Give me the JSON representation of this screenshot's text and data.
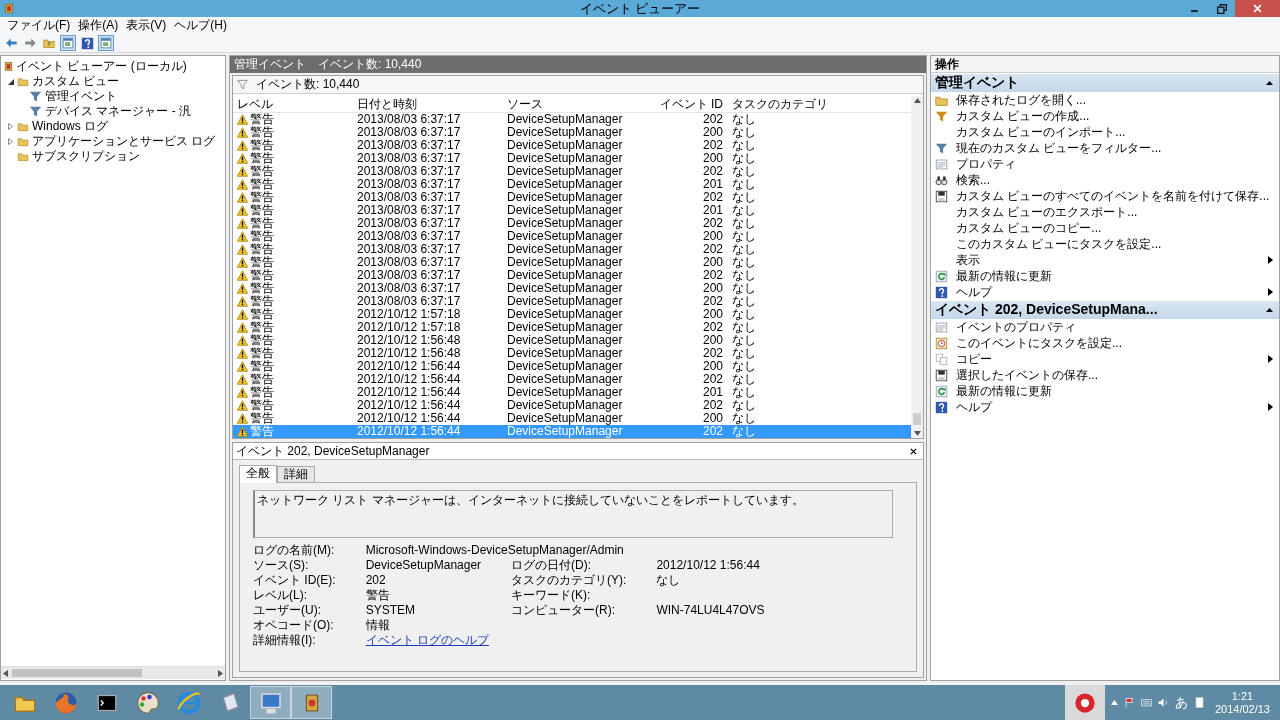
{
  "window": {
    "title": "イベント ビューアー"
  },
  "menu": [
    "ファイル(F)",
    "操作(A)",
    "表示(V)",
    "ヘルプ(H)"
  ],
  "toolbar": [
    {
      "kind": "back",
      "pressed": false
    },
    {
      "kind": "forward",
      "pressed": false
    },
    {
      "kind": "up",
      "pressed": false
    },
    {
      "kind": "pane",
      "pressed": true
    },
    {
      "kind": "help",
      "pressed": false
    },
    {
      "kind": "pane",
      "pressed": true
    }
  ],
  "tree": {
    "root": "イベント ビューアー (ローカル)",
    "items": [
      {
        "label": "カスタム ビュー",
        "expanded": true,
        "children": [
          {
            "label": "管理イベント",
            "kind": "view"
          },
          {
            "label": "デバイス マネージャー - 汎",
            "kind": "view"
          }
        ]
      },
      {
        "label": "Windows ログ",
        "expanded": false
      },
      {
        "label": "アプリケーションとサービス ログ",
        "expanded": false
      },
      {
        "label": "サブスクリプション"
      }
    ]
  },
  "list_panel": {
    "title": "管理イベント",
    "count": "イベント数: 10,440",
    "filter_text": "イベント数: 10,440",
    "columns": [
      "レベル",
      "日付と時刻",
      "ソース",
      "イベント ID",
      "タスクのカテゴリ"
    ],
    "rows": [
      {
        "level": "警告",
        "datetime": "2013/08/03 6:37:17",
        "source": "DeviceSetupManager",
        "event_id": "202",
        "category": "なし",
        "selected": false
      },
      {
        "level": "警告",
        "datetime": "2013/08/03 6:37:17",
        "source": "DeviceSetupManager",
        "event_id": "200",
        "category": "なし",
        "selected": false
      },
      {
        "level": "警告",
        "datetime": "2013/08/03 6:37:17",
        "source": "DeviceSetupManager",
        "event_id": "202",
        "category": "なし",
        "selected": false
      },
      {
        "level": "警告",
        "datetime": "2013/08/03 6:37:17",
        "source": "DeviceSetupManager",
        "event_id": "200",
        "category": "なし",
        "selected": false
      },
      {
        "level": "警告",
        "datetime": "2013/08/03 6:37:17",
        "source": "DeviceSetupManager",
        "event_id": "202",
        "category": "なし",
        "selected": false
      },
      {
        "level": "警告",
        "datetime": "2013/08/03 6:37:17",
        "source": "DeviceSetupManager",
        "event_id": "201",
        "category": "なし",
        "selected": false
      },
      {
        "level": "警告",
        "datetime": "2013/08/03 6:37:17",
        "source": "DeviceSetupManager",
        "event_id": "202",
        "category": "なし",
        "selected": false
      },
      {
        "level": "警告",
        "datetime": "2013/08/03 6:37:17",
        "source": "DeviceSetupManager",
        "event_id": "201",
        "category": "なし",
        "selected": false
      },
      {
        "level": "警告",
        "datetime": "2013/08/03 6:37:17",
        "source": "DeviceSetupManager",
        "event_id": "202",
        "category": "なし",
        "selected": false
      },
      {
        "level": "警告",
        "datetime": "2013/08/03 6:37:17",
        "source": "DeviceSetupManager",
        "event_id": "200",
        "category": "なし",
        "selected": false
      },
      {
        "level": "警告",
        "datetime": "2013/08/03 6:37:17",
        "source": "DeviceSetupManager",
        "event_id": "202",
        "category": "なし",
        "selected": false
      },
      {
        "level": "警告",
        "datetime": "2013/08/03 6:37:17",
        "source": "DeviceSetupManager",
        "event_id": "200",
        "category": "なし",
        "selected": false
      },
      {
        "level": "警告",
        "datetime": "2013/08/03 6:37:17",
        "source": "DeviceSetupManager",
        "event_id": "202",
        "category": "なし",
        "selected": false
      },
      {
        "level": "警告",
        "datetime": "2013/08/03 6:37:17",
        "source": "DeviceSetupManager",
        "event_id": "200",
        "category": "なし",
        "selected": false
      },
      {
        "level": "警告",
        "datetime": "2013/08/03 6:37:17",
        "source": "DeviceSetupManager",
        "event_id": "202",
        "category": "なし",
        "selected": false
      },
      {
        "level": "警告",
        "datetime": "2012/10/12 1:57:18",
        "source": "DeviceSetupManager",
        "event_id": "200",
        "category": "なし",
        "selected": false
      },
      {
        "level": "警告",
        "datetime": "2012/10/12 1:57:18",
        "source": "DeviceSetupManager",
        "event_id": "202",
        "category": "なし",
        "selected": false
      },
      {
        "level": "警告",
        "datetime": "2012/10/12 1:56:48",
        "source": "DeviceSetupManager",
        "event_id": "200",
        "category": "なし",
        "selected": false
      },
      {
        "level": "警告",
        "datetime": "2012/10/12 1:56:48",
        "source": "DeviceSetupManager",
        "event_id": "202",
        "category": "なし",
        "selected": false
      },
      {
        "level": "警告",
        "datetime": "2012/10/12 1:56:44",
        "source": "DeviceSetupManager",
        "event_id": "200",
        "category": "なし",
        "selected": false
      },
      {
        "level": "警告",
        "datetime": "2012/10/12 1:56:44",
        "source": "DeviceSetupManager",
        "event_id": "202",
        "category": "なし",
        "selected": false
      },
      {
        "level": "警告",
        "datetime": "2012/10/12 1:56:44",
        "source": "DeviceSetupManager",
        "event_id": "201",
        "category": "なし",
        "selected": false
      },
      {
        "level": "警告",
        "datetime": "2012/10/12 1:56:44",
        "source": "DeviceSetupManager",
        "event_id": "202",
        "category": "なし",
        "selected": false
      },
      {
        "level": "警告",
        "datetime": "2012/10/12 1:56:44",
        "source": "DeviceSetupManager",
        "event_id": "200",
        "category": "なし",
        "selected": false
      },
      {
        "level": "警告",
        "datetime": "2012/10/12 1:56:44",
        "source": "DeviceSetupManager",
        "event_id": "202",
        "category": "なし",
        "selected": true
      }
    ]
  },
  "details": {
    "title": "イベント 202, DeviceSetupManager",
    "tabs": [
      {
        "label": "全般",
        "selected": true
      },
      {
        "label": "詳細",
        "selected": false
      }
    ],
    "message": "ネットワーク リスト マネージャーは、インターネットに接続していないことをレポートしています。",
    "rows": [
      [
        {
          "label": "ログの名前(M):",
          "value": "Microsoft-Windows-DeviceSetupManager/Admin"
        }
      ],
      [
        {
          "label": "ソース(S):",
          "value": "DeviceSetupManager"
        },
        {
          "label": "ログの日付(D):",
          "value": "2012/10/12 1:56:44"
        }
      ],
      [
        {
          "label": "イベント ID(E):",
          "value": "202"
        },
        {
          "label": "タスクのカテゴリ(Y):",
          "value": "なし"
        }
      ],
      [
        {
          "label": "レベル(L):",
          "value": "警告"
        },
        {
          "label": "キーワード(K):"
        }
      ],
      [
        {
          "label": "ユーザー(U):",
          "value": "SYSTEM"
        },
        {
          "label": "コンピューター(R):",
          "value": "WIN-74LU4L47OVS"
        }
      ],
      [
        {
          "label": "オペコード(O):",
          "value": "情報"
        }
      ],
      [
        {
          "label": "詳細情報(I):",
          "value": "イベント ログのヘルプ",
          "kind": "link"
        }
      ]
    ]
  },
  "actions": {
    "title": "操作",
    "sections": [
      {
        "title": "管理イベント",
        "items": [
          {
            "label": "保存されたログを開く...",
            "kind": "folder",
            "submenu": false
          },
          {
            "label": "カスタム ビューの作成...",
            "kind": "create-filter",
            "submenu": false
          },
          {
            "label": "カスタム ビューのインポート...",
            "kind": "plain",
            "submenu": false
          },
          {
            "label": "現在のカスタム ビューをフィルター...",
            "kind": "filter",
            "submenu": false
          },
          {
            "label": "プロパティ",
            "kind": "properties",
            "submenu": false
          },
          {
            "label": "検索...",
            "kind": "search",
            "submenu": false
          },
          {
            "label": "カスタム ビューのすべてのイベントを名前を付けて保存...",
            "kind": "save",
            "submenu": false
          },
          {
            "label": "カスタム ビューのエクスポート...",
            "kind": "plain",
            "submenu": false
          },
          {
            "label": "カスタム ビューのコピー...",
            "kind": "plain",
            "submenu": false
          },
          {
            "label": "このカスタム ビューにタスクを設定...",
            "kind": "plain",
            "submenu": false
          },
          {
            "label": "表示",
            "kind": "plain",
            "submenu": true
          },
          {
            "label": "最新の情報に更新",
            "kind": "refresh",
            "submenu": false
          },
          {
            "label": "ヘルプ",
            "kind": "help",
            "submenu": true
          }
        ]
      },
      {
        "title": "イベント 202, DeviceSetupMana...",
        "items": [
          {
            "label": "イベントのプロパティ",
            "kind": "properties",
            "submenu": false
          },
          {
            "label": "このイベントにタスクを設定...",
            "kind": "task",
            "submenu": false
          },
          {
            "label": "コピー",
            "kind": "copy",
            "submenu": true
          },
          {
            "label": "選択したイベントの保存...",
            "kind": "save",
            "submenu": false
          },
          {
            "label": "最新の情報に更新",
            "kind": "refresh",
            "submenu": false
          },
          {
            "label": "ヘルプ",
            "kind": "help",
            "submenu": true
          }
        ]
      }
    ]
  },
  "taskbar": {
    "apps": [
      {
        "kind": "explorer",
        "active": false
      },
      {
        "kind": "firefox",
        "active": false
      },
      {
        "kind": "console",
        "active": false
      },
      {
        "kind": "paint",
        "active": false
      },
      {
        "kind": "ie",
        "active": false
      },
      {
        "kind": "generic",
        "active": false
      },
      {
        "kind": "network",
        "active": true
      },
      {
        "kind": "eventviewer",
        "active": true
      }
    ],
    "ime": "あ",
    "time": "1:21",
    "date": "2014/02/13"
  }
}
